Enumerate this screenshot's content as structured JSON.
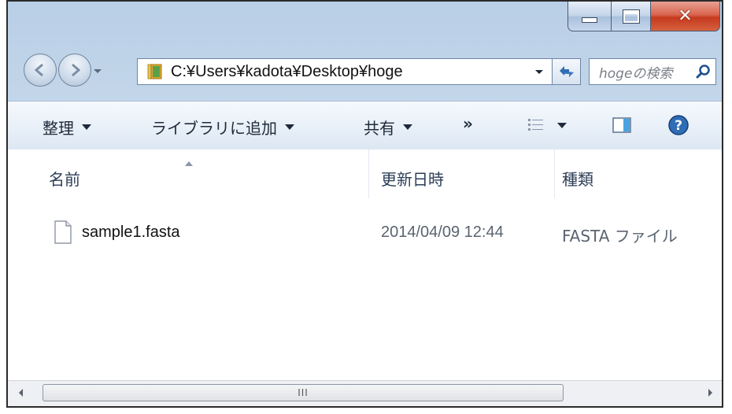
{
  "window": {
    "caption_buttons": {
      "minimize": "minimize",
      "maximize": "maximize",
      "close": "close"
    }
  },
  "nav": {
    "address": "C:¥Users¥kadota¥Desktop¥hoge",
    "search_placeholder": "hogeの検索"
  },
  "toolbar": {
    "organize": "整理",
    "add_to_library": "ライブラリに追加",
    "share": "共有",
    "more": "»"
  },
  "columns": {
    "name": "名前",
    "date": "更新日時",
    "type": "種類"
  },
  "files": [
    {
      "name": "sample1.fasta",
      "date": "2014/04/09 12:44",
      "type": "FASTA ファイル"
    }
  ],
  "scrollbar": {
    "grip": "III"
  },
  "colors": {
    "accent": "#2f6db5",
    "close": "#c53a1f",
    "folder": "#d9a82a"
  }
}
